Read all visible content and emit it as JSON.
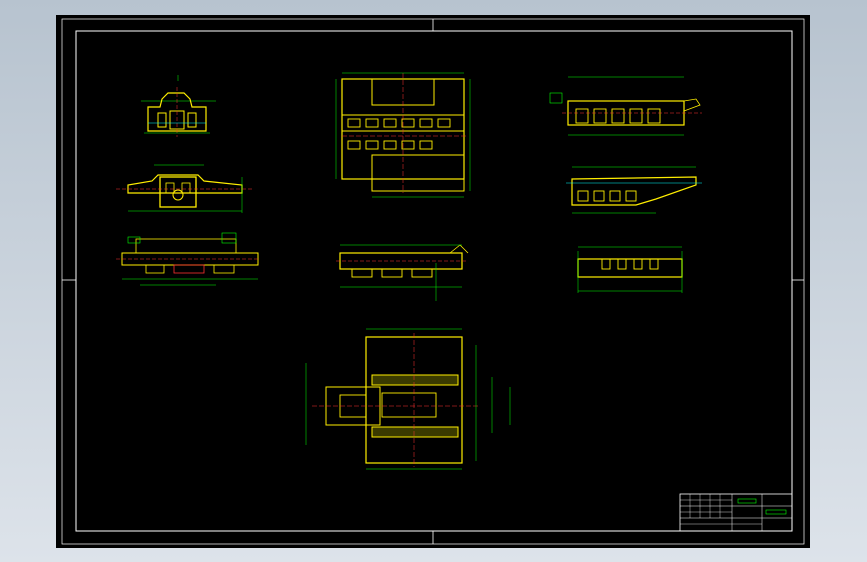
{
  "drawing": {
    "colors": {
      "background": "#000000",
      "frame": "#ffffff",
      "outline": "#ffee00",
      "dimension": "#00ff00",
      "center_line": "#ff3030",
      "hidden": "#00ffff"
    },
    "scale_mark": "",
    "technical_requirements": {
      "title": "",
      "lines": []
    },
    "title_block": {
      "drawing_name": "",
      "drawing_number": ""
    }
  }
}
